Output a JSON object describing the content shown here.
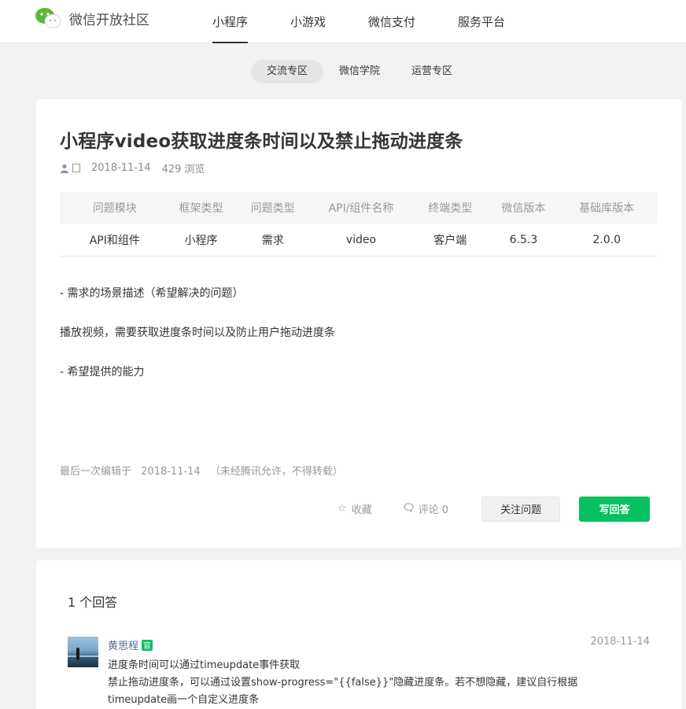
{
  "header": {
    "logo_text": "微信开放社区",
    "nav": [
      {
        "label": "小程序",
        "active": true
      },
      {
        "label": "小游戏",
        "active": false
      },
      {
        "label": "微信支付",
        "active": false
      },
      {
        "label": "服务平台",
        "active": false
      }
    ]
  },
  "subnav": [
    {
      "label": "交流专区",
      "active": true
    },
    {
      "label": "微信学院",
      "active": false
    },
    {
      "label": "运营专区",
      "active": false
    }
  ],
  "post": {
    "title": "小程序video获取进度条时间以及禁止拖动进度条",
    "author": "",
    "date": "2018-11-14",
    "views": "429 浏览",
    "table": {
      "headers": [
        "问题模块",
        "框架类型",
        "问题类型",
        "API/组件名称",
        "终端类型",
        "微信版本",
        "基础库版本"
      ],
      "values": [
        "API和组件",
        "小程序",
        "需求",
        "video",
        "客户端",
        "6.5.3",
        "2.0.0"
      ]
    },
    "body": [
      "- 需求的场景描述（希望解决的问题）",
      "播放视频，需要获取进度条时间以及防止用户拖动进度条",
      "- 希望提供的能力"
    ],
    "edit_note": {
      "prefix": "最后一次编辑于",
      "date": "2018-11-14",
      "copyright": "（未经腾讯允许，不得转载）"
    },
    "actions": {
      "collect_label": "收藏",
      "comment_label": "评论 0",
      "follow_label": "关注问题",
      "answer_label": "写回答"
    }
  },
  "answers": {
    "count_label": "1 个回答",
    "items": [
      {
        "author": "黄思程",
        "badge": "官",
        "date": "2018-11-14",
        "lines": [
          "进度条时间可以通过timeupdate事件获取",
          "禁止拖动进度条，可以通过设置show-progress=\"{{false}}\"隐藏进度条。若不想隐藏，建议自行根据",
          "timeupdate画一个自定义进度条"
        ]
      }
    ]
  },
  "colors": {
    "brand_green": "#07c160",
    "link_blue": "#576b95",
    "page_bg": "#f2f2f2"
  },
  "icons": [
    "wechat-logo-icon",
    "user-icon",
    "star-icon",
    "comment-icon"
  ]
}
